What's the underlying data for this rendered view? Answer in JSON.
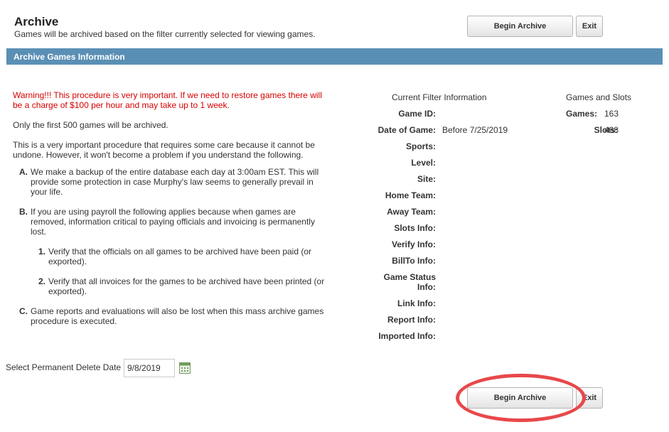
{
  "header": {
    "title": "Archive",
    "subtitle": "Games will be archived based on the filter currently selected for viewing games.",
    "begin_archive_label": "Begin Archive",
    "exit_label": "Exit"
  },
  "section": {
    "title": "Archive Games Information"
  },
  "info": {
    "warning": "Warning!!! This procedure is very important. If we need to restore games there will be a charge of $100 per hour and may take up to 1 week.",
    "limit_note": "Only the first 500 games will be archived.",
    "intro": "This is a very important procedure that requires some care because it cannot be undone. However, it won't become a problem if you understand the following.",
    "items": [
      {
        "marker": "A.",
        "text": "We make a backup of the entire database each day at 3:00am EST. This will provide some protection in case Murphy's law seems to generally prevail in your life."
      },
      {
        "marker": "B.",
        "text": "If you are using payroll the following applies because when games are removed, information critical to paying officials and invoicing is permanently lost."
      },
      {
        "marker": "C.",
        "text": "Game reports and evaluations will also be lost when this mass archive games procedure is executed."
      }
    ],
    "subitems": [
      {
        "marker": "1.",
        "text": "Verify that the officials on all games to be archived have been paid (or exported)."
      },
      {
        "marker": "2.",
        "text": "Verify that all invoices for the games to be archived have been printed (or exported)."
      }
    ]
  },
  "filter": {
    "heading": "Current Filter Information",
    "fields": [
      {
        "label": "Game ID:",
        "value": ""
      },
      {
        "label": "Date of Game:",
        "value": "Before 7/25/2019"
      },
      {
        "label": "Sports:",
        "value": ""
      },
      {
        "label": "Level:",
        "value": ""
      },
      {
        "label": "Site:",
        "value": ""
      },
      {
        "label": "Home Team:",
        "value": ""
      },
      {
        "label": "Away Team:",
        "value": ""
      },
      {
        "label": "Slots Info:",
        "value": ""
      },
      {
        "label": "Verify Info:",
        "value": ""
      },
      {
        "label": "BillTo Info:",
        "value": ""
      },
      {
        "label": "Game Status Info:",
        "value": ""
      },
      {
        "label": "Link Info:",
        "value": ""
      },
      {
        "label": "Report Info:",
        "value": ""
      },
      {
        "label": "Imported Info:",
        "value": ""
      }
    ]
  },
  "games_slots": {
    "heading": "Games and Slots",
    "games_label": "Games:",
    "games_value": "163",
    "slots_label": "Slots:",
    "slots_value": "468"
  },
  "delete_date": {
    "label": "Select Permanent Delete Date",
    "value": "9/8/2019"
  },
  "footer": {
    "begin_archive_label": "Begin Archive",
    "exit_label": "Exit"
  },
  "colors": {
    "section_bar": "#5a8fb5",
    "warning_text": "#d60000",
    "highlight_ring": "#e8484a"
  }
}
